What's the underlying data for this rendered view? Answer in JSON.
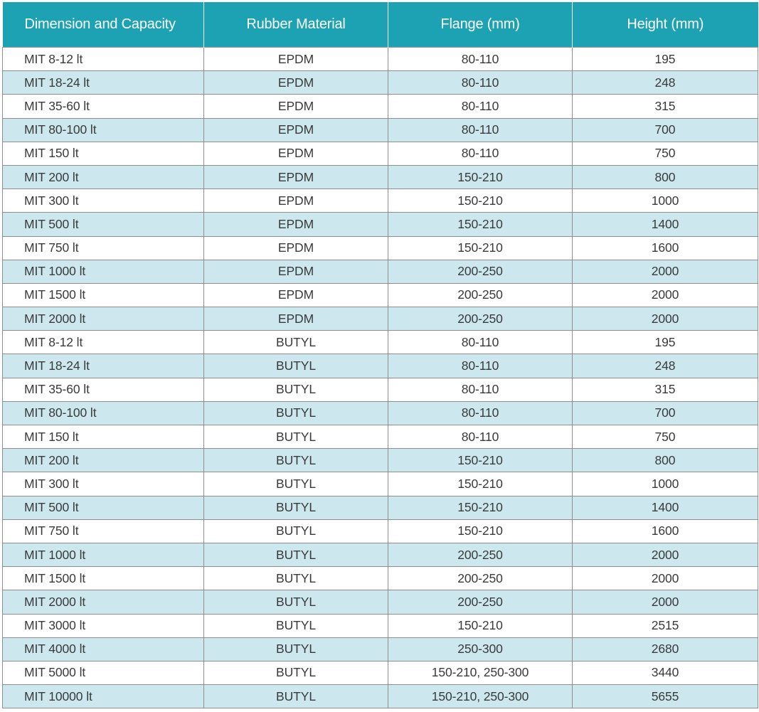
{
  "table": {
    "headers": [
      "Dimension and Capacity",
      "Rubber Material",
      "Flange (mm)",
      "Height (mm)"
    ],
    "rows": [
      [
        "MIT 8-12 lt",
        "EPDM",
        "80-110",
        "195"
      ],
      [
        "MIT 18-24 lt",
        "EPDM",
        "80-110",
        "248"
      ],
      [
        "MIT 35-60 lt",
        "EPDM",
        "80-110",
        "315"
      ],
      [
        "MIT 80-100 lt",
        "EPDM",
        "80-110",
        "700"
      ],
      [
        "MIT 150 lt",
        "EPDM",
        "80-110",
        "750"
      ],
      [
        "MIT 200 lt",
        "EPDM",
        "150-210",
        "800"
      ],
      [
        "MIT 300 lt",
        "EPDM",
        "150-210",
        "1000"
      ],
      [
        "MIT 500 lt",
        "EPDM",
        "150-210",
        "1400"
      ],
      [
        "MIT 750 lt",
        "EPDM",
        "150-210",
        "1600"
      ],
      [
        "MIT 1000 lt",
        "EPDM",
        "200-250",
        "2000"
      ],
      [
        "MIT 1500 lt",
        "EPDM",
        "200-250",
        "2000"
      ],
      [
        "MIT 2000 lt",
        "EPDM",
        "200-250",
        "2000"
      ],
      [
        "MIT 8-12 lt",
        "BUTYL",
        "80-110",
        "195"
      ],
      [
        "MIT 18-24 lt",
        "BUTYL",
        "80-110",
        "248"
      ],
      [
        "MIT 35-60 lt",
        "BUTYL",
        "80-110",
        "315"
      ],
      [
        "MIT 80-100 lt",
        "BUTYL",
        "80-110",
        "700"
      ],
      [
        "MIT 150 lt",
        "BUTYL",
        "80-110",
        "750"
      ],
      [
        "MIT 200 lt",
        "BUTYL",
        "150-210",
        "800"
      ],
      [
        "MIT 300 lt",
        "BUTYL",
        "150-210",
        "1000"
      ],
      [
        "MIT 500 lt",
        "BUTYL",
        "150-210",
        "1400"
      ],
      [
        "MIT 750 lt",
        "BUTYL",
        "150-210",
        "1600"
      ],
      [
        "MIT 1000 lt",
        "BUTYL",
        "200-250",
        "2000"
      ],
      [
        "MIT 1500 lt",
        "BUTYL",
        "200-250",
        "2000"
      ],
      [
        "MIT 2000 lt",
        "BUTYL",
        "200-250",
        "2000"
      ],
      [
        "MIT 3000 lt",
        "BUTYL",
        "150-210",
        "2515"
      ],
      [
        "MIT 4000 lt",
        "BUTYL",
        "250-300",
        "2680"
      ],
      [
        "MIT 5000 lt",
        "BUTYL",
        "150-210, 250-300",
        "3440"
      ],
      [
        "MIT 10000 lt",
        "BUTYL",
        "150-210, 250-300",
        "5655"
      ]
    ]
  },
  "colors": {
    "header_bg": "#1da2b3",
    "header_text": "#ffffff",
    "stripe_bg": "#cce8ee",
    "row_bg": "#ffffff",
    "cell_text": "#3a3a3a",
    "border": "#8e8e8e"
  }
}
